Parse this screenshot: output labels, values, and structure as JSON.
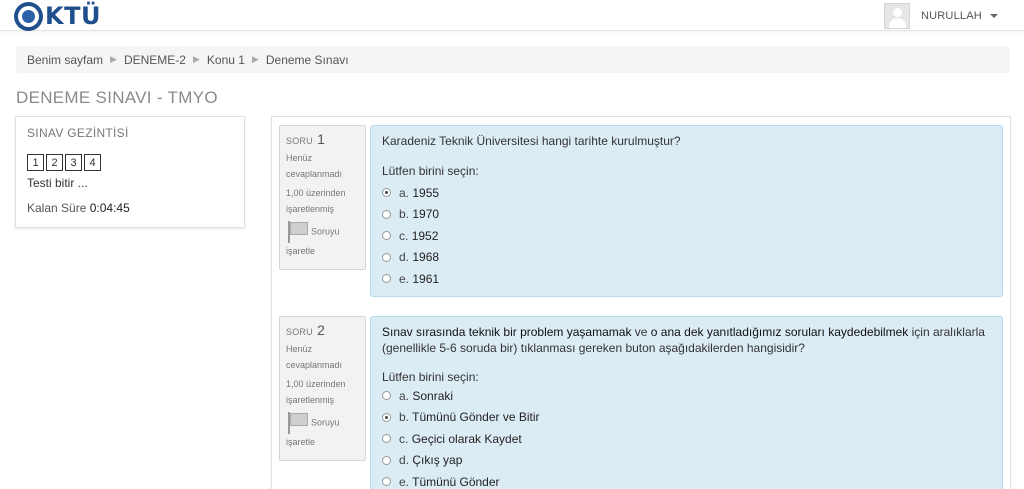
{
  "header": {
    "logo_text": "KTÜ",
    "user_name": "NURULLAH"
  },
  "breadcrumb": [
    "Benim sayfam",
    "DENEME-2",
    "Konu 1",
    "Deneme Sınavı"
  ],
  "page_title": "DENEME SINAVI - TMYO",
  "navigation": {
    "title": "SINAV GEZİNTİSİ",
    "buttons": [
      "1",
      "2",
      "3",
      "4"
    ],
    "finish_label": "Testi bitir ...",
    "timer_label": "Kalan Süre",
    "timer_value": "0:04:45"
  },
  "questions": [
    {
      "label": "SORU",
      "number": "1",
      "state": "Henüz cevaplanmadı",
      "grade": "1,00 üzerinden işaretlenmiş",
      "flag_label": "Soruyu işaretle",
      "text_parts": [
        {
          "t": "Karadeniz Teknik Üniversitesi hangi tarihte kurulmuştur?",
          "b": false
        }
      ],
      "prompt": "Lütfen birini seçin:",
      "options": [
        {
          "letter": "a.",
          "text": "1955",
          "checked": true
        },
        {
          "letter": "b.",
          "text": "1970",
          "checked": false
        },
        {
          "letter": "c.",
          "text": "1952",
          "checked": false
        },
        {
          "letter": "d.",
          "text": "1968",
          "checked": false
        },
        {
          "letter": "e.",
          "text": "1961",
          "checked": false
        }
      ]
    },
    {
      "label": "SORU",
      "number": "2",
      "state": "Henüz cevaplanmadı",
      "grade": "1,00 üzerinden işaretlenmiş",
      "flag_label": "Soruyu işaretle",
      "text_parts": [
        {
          "t": "Sınav sırasında teknik bir problem yaşamamak",
          "b": true
        },
        {
          "t": " ve ",
          "b": false
        },
        {
          "t": "o ana dek yanıtladığımız soruları kaydedebilmek",
          "b": true
        },
        {
          "t": " için aralıklarla (genellikle 5-6 soruda bir) tıklanması gereken buton aşağıdakilerden hangisidir?",
          "b": false
        }
      ],
      "prompt": "Lütfen birini seçin:",
      "options": [
        {
          "letter": "a.",
          "text": "Sonraki",
          "checked": false
        },
        {
          "letter": "b.",
          "text": "Tümünü Gönder ve Bitir",
          "checked": true
        },
        {
          "letter": "c.",
          "text": "Geçici olarak Kaydet",
          "checked": false
        },
        {
          "letter": "d.",
          "text": "Çıkış yap",
          "checked": false
        },
        {
          "letter": "e.",
          "text": "Tümünü Gönder",
          "checked": false
        }
      ]
    }
  ],
  "colors": {
    "brand": "#1f4f8c",
    "question_bg": "#dcecf5",
    "question_border": "#b8dbef",
    "info_bg": "#f2f2f2"
  }
}
